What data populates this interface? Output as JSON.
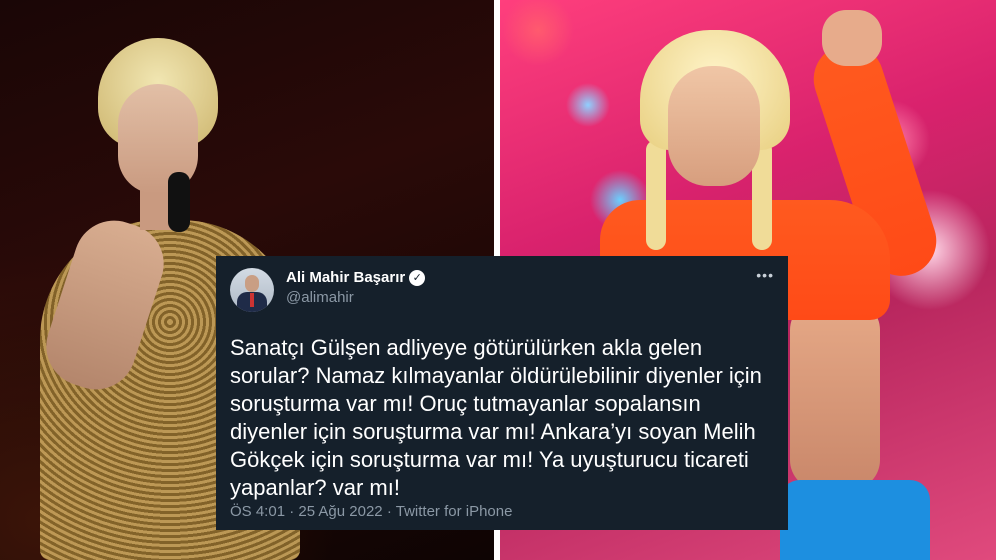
{
  "tweet": {
    "display_name": "Ali Mahir Başarır",
    "handle": "@alimahir",
    "verified_icon": "verified-badge-icon",
    "more_icon": "more-options-icon",
    "more_label": "•••",
    "text": "Sanatçı Gülşen adliyeye götürülürken akla gelen\nsorular? Namaz kılmayanlar öldürülebilinir diyenler için\nsoruşturma var mı! Oruç tutmayanlar sopalansın\ndiyenler için soruşturma var mı! Ankara’yı soyan Melih\nGökçek için soruşturma var mı! Ya uyuşturucu ticareti\nyapanlar?  var mı!",
    "time": "ÖS 4:01",
    "sep1": "·",
    "date": "25 Ağu 2022",
    "sep2": "·",
    "source": "Twitter for iPhone"
  },
  "colors": {
    "card_bg": "#15202b",
    "text_primary": "#ffffff",
    "text_secondary": "#8b98a5"
  }
}
